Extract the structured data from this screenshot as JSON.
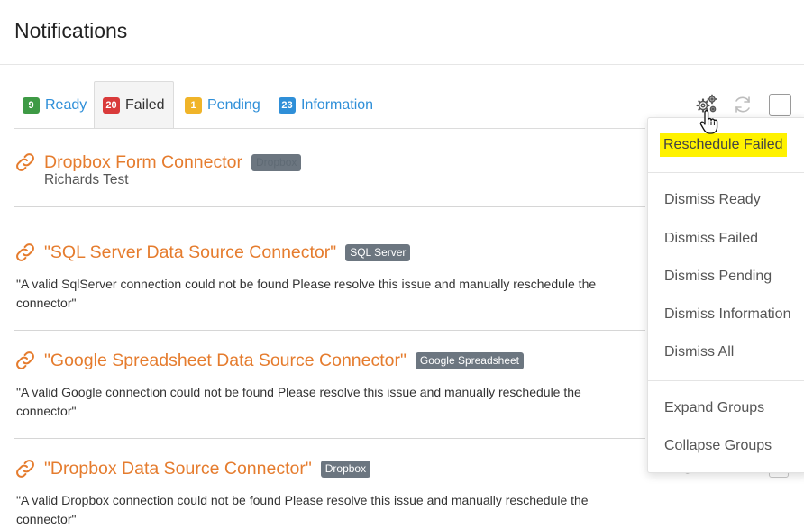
{
  "page": {
    "title": "Notifications"
  },
  "tabs": [
    {
      "count": "9",
      "label": "Ready",
      "color": "#3e9a45",
      "active": false
    },
    {
      "count": "20",
      "label": "Failed",
      "color": "#d93a3a",
      "active": true
    },
    {
      "count": "1",
      "label": "Pending",
      "color": "#f0b429",
      "active": false
    },
    {
      "count": "23",
      "label": "Information",
      "color": "#2f8fd8",
      "active": false
    }
  ],
  "items": [
    {
      "title": "Dropbox Form Connector",
      "tag": "Dropbox",
      "subtitle": "Richards Test",
      "message": ""
    },
    {
      "title": "\"SQL Server Data Source Connector\"",
      "tag": "SQL Server",
      "subtitle": "",
      "message": "\"A valid SqlServer connection could not be found Please resolve this issue and manually reschedule the connector\""
    },
    {
      "title": "\"Google Spreadsheet Data Source Connector\"",
      "tag": "Google Spreadsheet",
      "subtitle": "",
      "message": "\"A valid Google connection could not be found Please resolve this issue and manually reschedule the connector\""
    },
    {
      "title": "\"Dropbox Data Source Connector\"",
      "tag": "Dropbox",
      "subtitle": "",
      "message": "\"A valid Dropbox connection could not be found Please resolve this issue and manually reschedule the connector\""
    }
  ],
  "menu": {
    "reschedule_failed": "Reschedule Failed",
    "dismiss_ready": "Dismiss Ready",
    "dismiss_failed": "Dismiss Failed",
    "dismiss_pending": "Dismiss Pending",
    "dismiss_information": "Dismiss Information",
    "dismiss_all": "Dismiss All",
    "expand_groups": "Expand Groups",
    "collapse_groups": "Collapse Groups"
  },
  "colors": {
    "accent_orange": "#e57c2e",
    "link_blue": "#2f8fd8",
    "highlight": "#fff200",
    "tag_gray": "#6c7680"
  },
  "icons": {
    "settings": "gears-icon",
    "refresh": "refresh-icon",
    "link": "link-icon",
    "cursor": "hand-pointer-icon"
  }
}
